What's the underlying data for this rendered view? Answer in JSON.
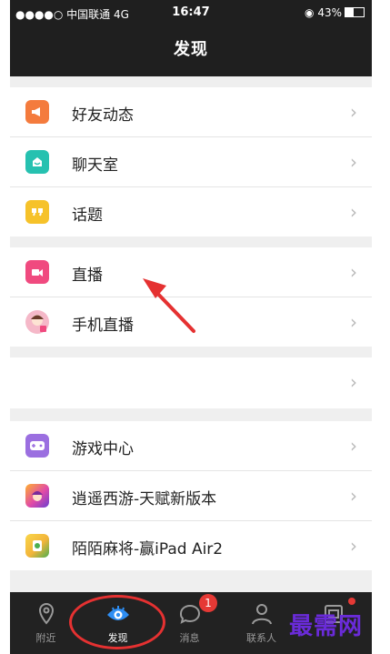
{
  "status_bar": {
    "carrier": "●●●●○ 中国联通  4G",
    "time": "16:47",
    "battery": "◉ 43%"
  },
  "header": {
    "title": "发现"
  },
  "groups": [
    {
      "items": [
        {
          "label": "好友动态",
          "icon": "megaphone-icon",
          "color": "#f47b3d"
        },
        {
          "label": "聊天室",
          "icon": "chat-room-icon",
          "color": "#26c1b0"
        },
        {
          "label": "话题",
          "icon": "quote-icon",
          "color": "#f6c22a"
        }
      ]
    },
    {
      "items": [
        {
          "label": "直播",
          "icon": "video-camera-icon",
          "color": "#f04a7f"
        },
        {
          "label": "手机直播",
          "icon": "avatar-thumbnail-icon",
          "color": "#f5b8c8"
        }
      ]
    },
    {
      "items": [
        {
          "label": "",
          "icon": "",
          "color": ""
        }
      ]
    },
    {
      "items": [
        {
          "label": "游戏中心",
          "icon": "gamepad-icon",
          "color": "#9b6fe0"
        },
        {
          "label": "逍遥西游-天赋新版本",
          "icon": "game-xiaoyao-icon",
          "color": "#e04aa8"
        },
        {
          "label": "陌陌麻将-赢iPad Air2",
          "icon": "game-mahjong-icon",
          "color": "#f2b43a"
        }
      ]
    }
  ],
  "tabbar": {
    "tabs": [
      {
        "label": "附近",
        "icon": "location-pin-icon"
      },
      {
        "label": "发现",
        "icon": "eye-icon",
        "active": true
      },
      {
        "label": "消息",
        "icon": "chat-bubble-icon",
        "badge": "1"
      },
      {
        "label": "联系人",
        "icon": "person-icon"
      },
      {
        "label": "",
        "icon": "profile-card-icon",
        "dot": true
      }
    ]
  },
  "watermark": "最需网",
  "colors": {
    "accent": "#2e8ef3",
    "annotation": "#e53131"
  }
}
